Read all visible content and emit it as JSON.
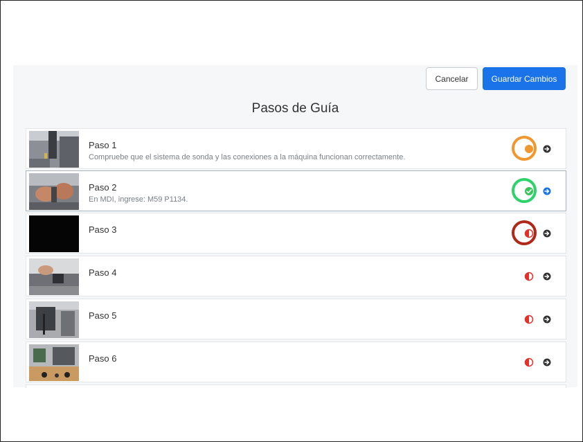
{
  "toolbar": {
    "cancel_label": "Cancelar",
    "save_label": "Guardar Cambios"
  },
  "page": {
    "title": "Pasos de Guía"
  },
  "colors": {
    "primary": "#1a73e8",
    "in_progress": "#f0972f",
    "complete": "#3cc45c",
    "needs_attention": "#e0312a",
    "highlight_ring_red": "#b02818",
    "highlight_ring_green": "#2ed26b"
  },
  "steps": [
    {
      "title": "Paso 1",
      "description": "Compruebe que el sistema de sonda y las conexiones a la máquina funcionan correctamente.",
      "status": "in-progress",
      "highlighted": true
    },
    {
      "title": "Paso 2",
      "description": "En MDI, ingrese: M59 P1134.",
      "status": "complete",
      "highlighted": true
    },
    {
      "title": "Paso 3",
      "description": "",
      "status": "needs-attention",
      "highlighted": true
    },
    {
      "title": "Paso 4",
      "description": "",
      "status": "needs-attention",
      "highlighted": false
    },
    {
      "title": "Paso 5",
      "description": "",
      "status": "needs-attention",
      "highlighted": false
    },
    {
      "title": "Paso 6",
      "description": "",
      "status": "needs-attention",
      "highlighted": false
    }
  ]
}
